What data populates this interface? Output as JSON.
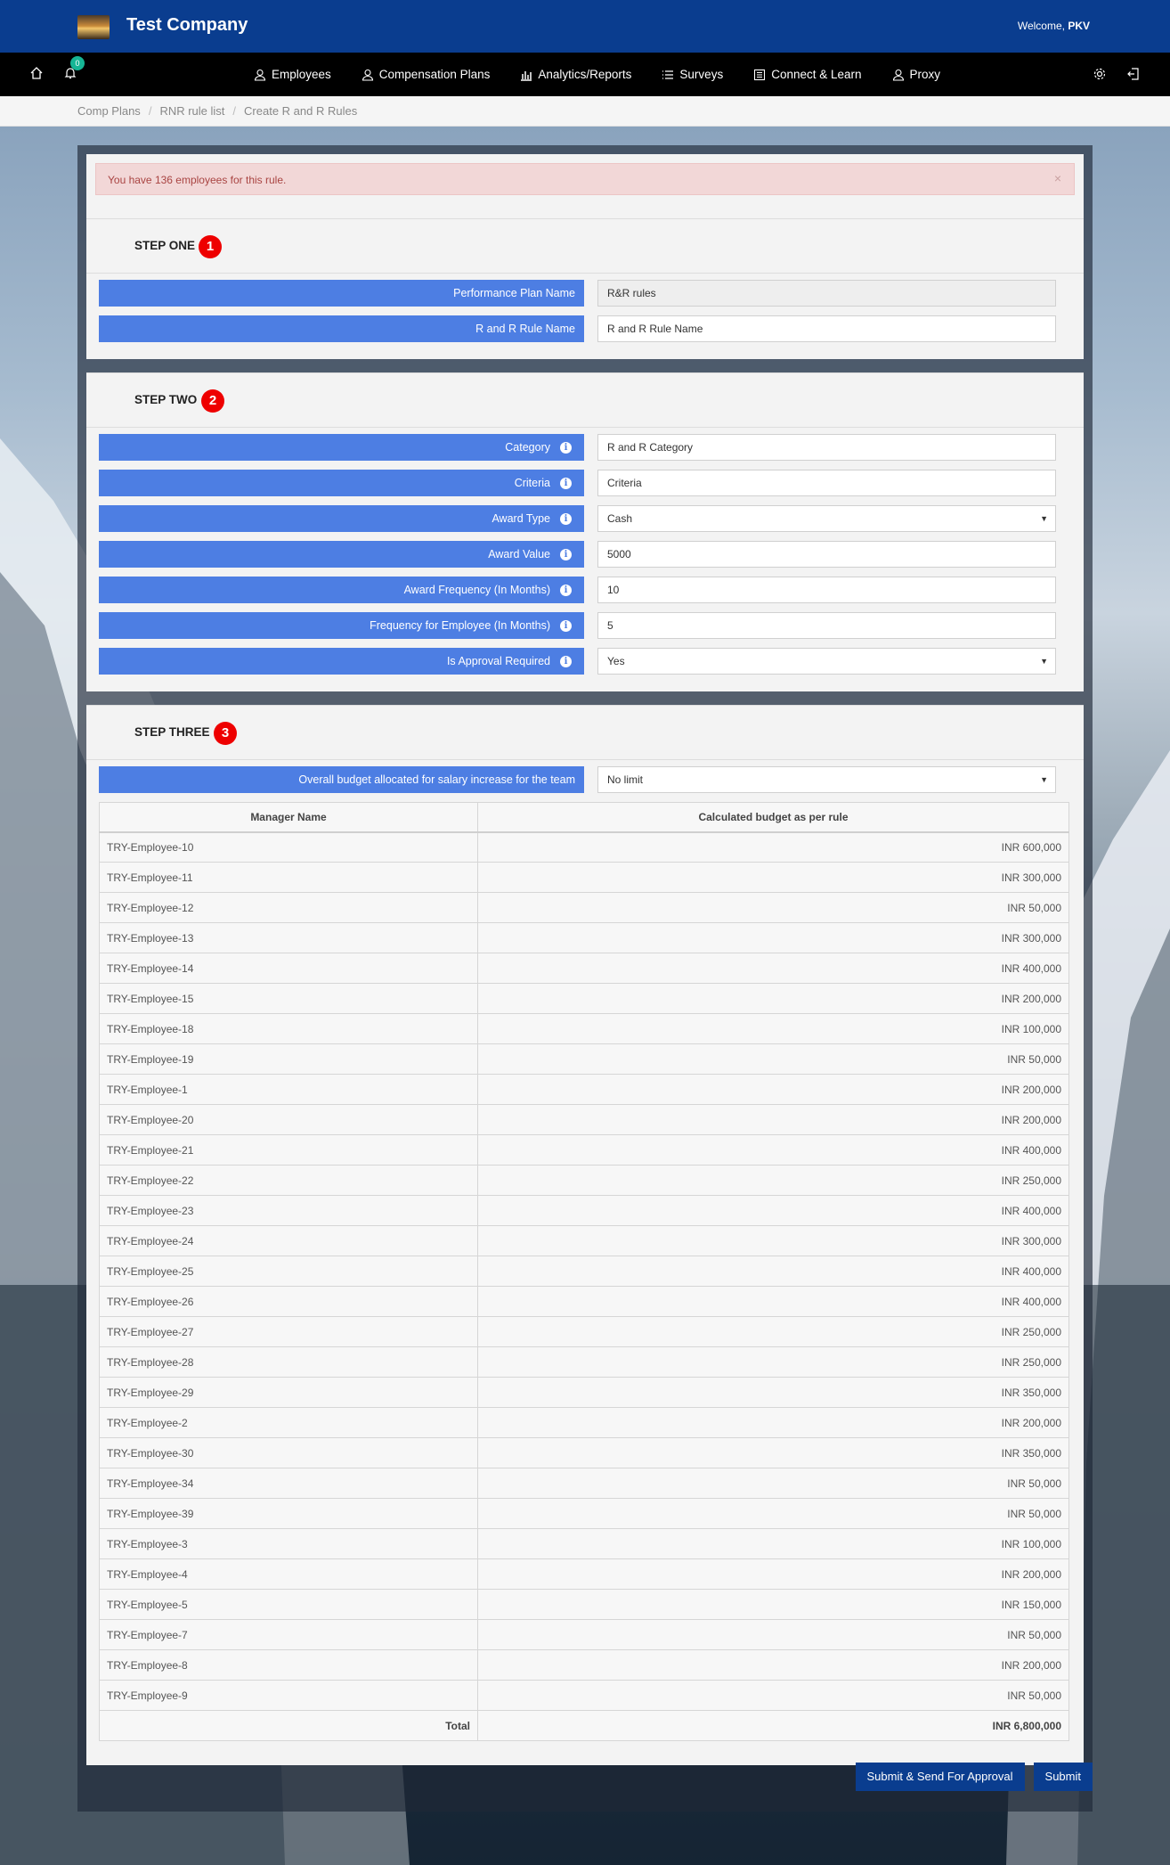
{
  "header": {
    "company": "Test Company",
    "welcome_prefix": "Welcome, ",
    "user": "PKV"
  },
  "nav": {
    "notification_count": "0",
    "items": [
      {
        "label": "Employees",
        "icon": "user-icon"
      },
      {
        "label": "Compensation Plans",
        "icon": "user-icon"
      },
      {
        "label": "Analytics/Reports",
        "icon": "bar-chart-icon"
      },
      {
        "label": "Surveys",
        "icon": "list-icon"
      },
      {
        "label": "Connect & Learn",
        "icon": "book-icon"
      },
      {
        "label": "Proxy",
        "icon": "user-icon"
      }
    ]
  },
  "breadcrumb": [
    "Comp Plans",
    "RNR rule list",
    "Create R and R Rules"
  ],
  "alert": {
    "text": "You have 136 employees for this rule.",
    "close": "×"
  },
  "step1": {
    "title": "STEP ONE",
    "num": "1",
    "fields": [
      {
        "label": "Performance Plan Name",
        "value": "R&R rules"
      },
      {
        "label": "R and R Rule Name",
        "value": "R and R Rule Name"
      }
    ]
  },
  "step2": {
    "title": "STEP TWO",
    "num": "2",
    "fields": [
      {
        "label": "Category",
        "value": "R and R Category"
      },
      {
        "label": "Criteria",
        "value": "Criteria"
      },
      {
        "label": "Award Type",
        "value": "Cash"
      },
      {
        "label": "Award Value",
        "value": "5000"
      },
      {
        "label": "Award Frequency (In Months)",
        "value": "10"
      },
      {
        "label": "Frequency for Employee (In Months)",
        "value": "5"
      },
      {
        "label": "Is Approval Required",
        "value": "Yes"
      }
    ]
  },
  "step3": {
    "title": "STEP THREE",
    "num": "3",
    "budget_label": "Overall budget allocated for salary increase for the team",
    "budget_value": "No limit",
    "columns": [
      "Manager Name",
      "Calculated budget as per rule"
    ],
    "rows": [
      [
        "TRY-Employee-10",
        "INR 600,000"
      ],
      [
        "TRY-Employee-11",
        "INR 300,000"
      ],
      [
        "TRY-Employee-12",
        "INR 50,000"
      ],
      [
        "TRY-Employee-13",
        "INR 300,000"
      ],
      [
        "TRY-Employee-14",
        "INR 400,000"
      ],
      [
        "TRY-Employee-15",
        "INR 200,000"
      ],
      [
        "TRY-Employee-18",
        "INR 100,000"
      ],
      [
        "TRY-Employee-19",
        "INR 50,000"
      ],
      [
        "TRY-Employee-1",
        "INR 200,000"
      ],
      [
        "TRY-Employee-20",
        "INR 200,000"
      ],
      [
        "TRY-Employee-21",
        "INR 400,000"
      ],
      [
        "TRY-Employee-22",
        "INR 250,000"
      ],
      [
        "TRY-Employee-23",
        "INR 400,000"
      ],
      [
        "TRY-Employee-24",
        "INR 300,000"
      ],
      [
        "TRY-Employee-25",
        "INR 400,000"
      ],
      [
        "TRY-Employee-26",
        "INR 400,000"
      ],
      [
        "TRY-Employee-27",
        "INR 250,000"
      ],
      [
        "TRY-Employee-28",
        "INR 250,000"
      ],
      [
        "TRY-Employee-29",
        "INR 350,000"
      ],
      [
        "TRY-Employee-2",
        "INR 200,000"
      ],
      [
        "TRY-Employee-30",
        "INR 350,000"
      ],
      [
        "TRY-Employee-34",
        "INR 50,000"
      ],
      [
        "TRY-Employee-39",
        "INR 50,000"
      ],
      [
        "TRY-Employee-3",
        "INR 100,000"
      ],
      [
        "TRY-Employee-4",
        "INR 200,000"
      ],
      [
        "TRY-Employee-5",
        "INR 150,000"
      ],
      [
        "TRY-Employee-7",
        "INR 50,000"
      ],
      [
        "TRY-Employee-8",
        "INR 200,000"
      ],
      [
        "TRY-Employee-9",
        "INR 50,000"
      ]
    ],
    "total_label": "Total",
    "total_value": "INR 6,800,000"
  },
  "actions": {
    "submit_send": "Submit & Send For Approval",
    "submit": "Submit"
  },
  "colors": {
    "header": "#0a3d8f",
    "label": "#4d7ee3",
    "step_badge": "#ee0000",
    "alert_bg": "#f2d7d7"
  }
}
